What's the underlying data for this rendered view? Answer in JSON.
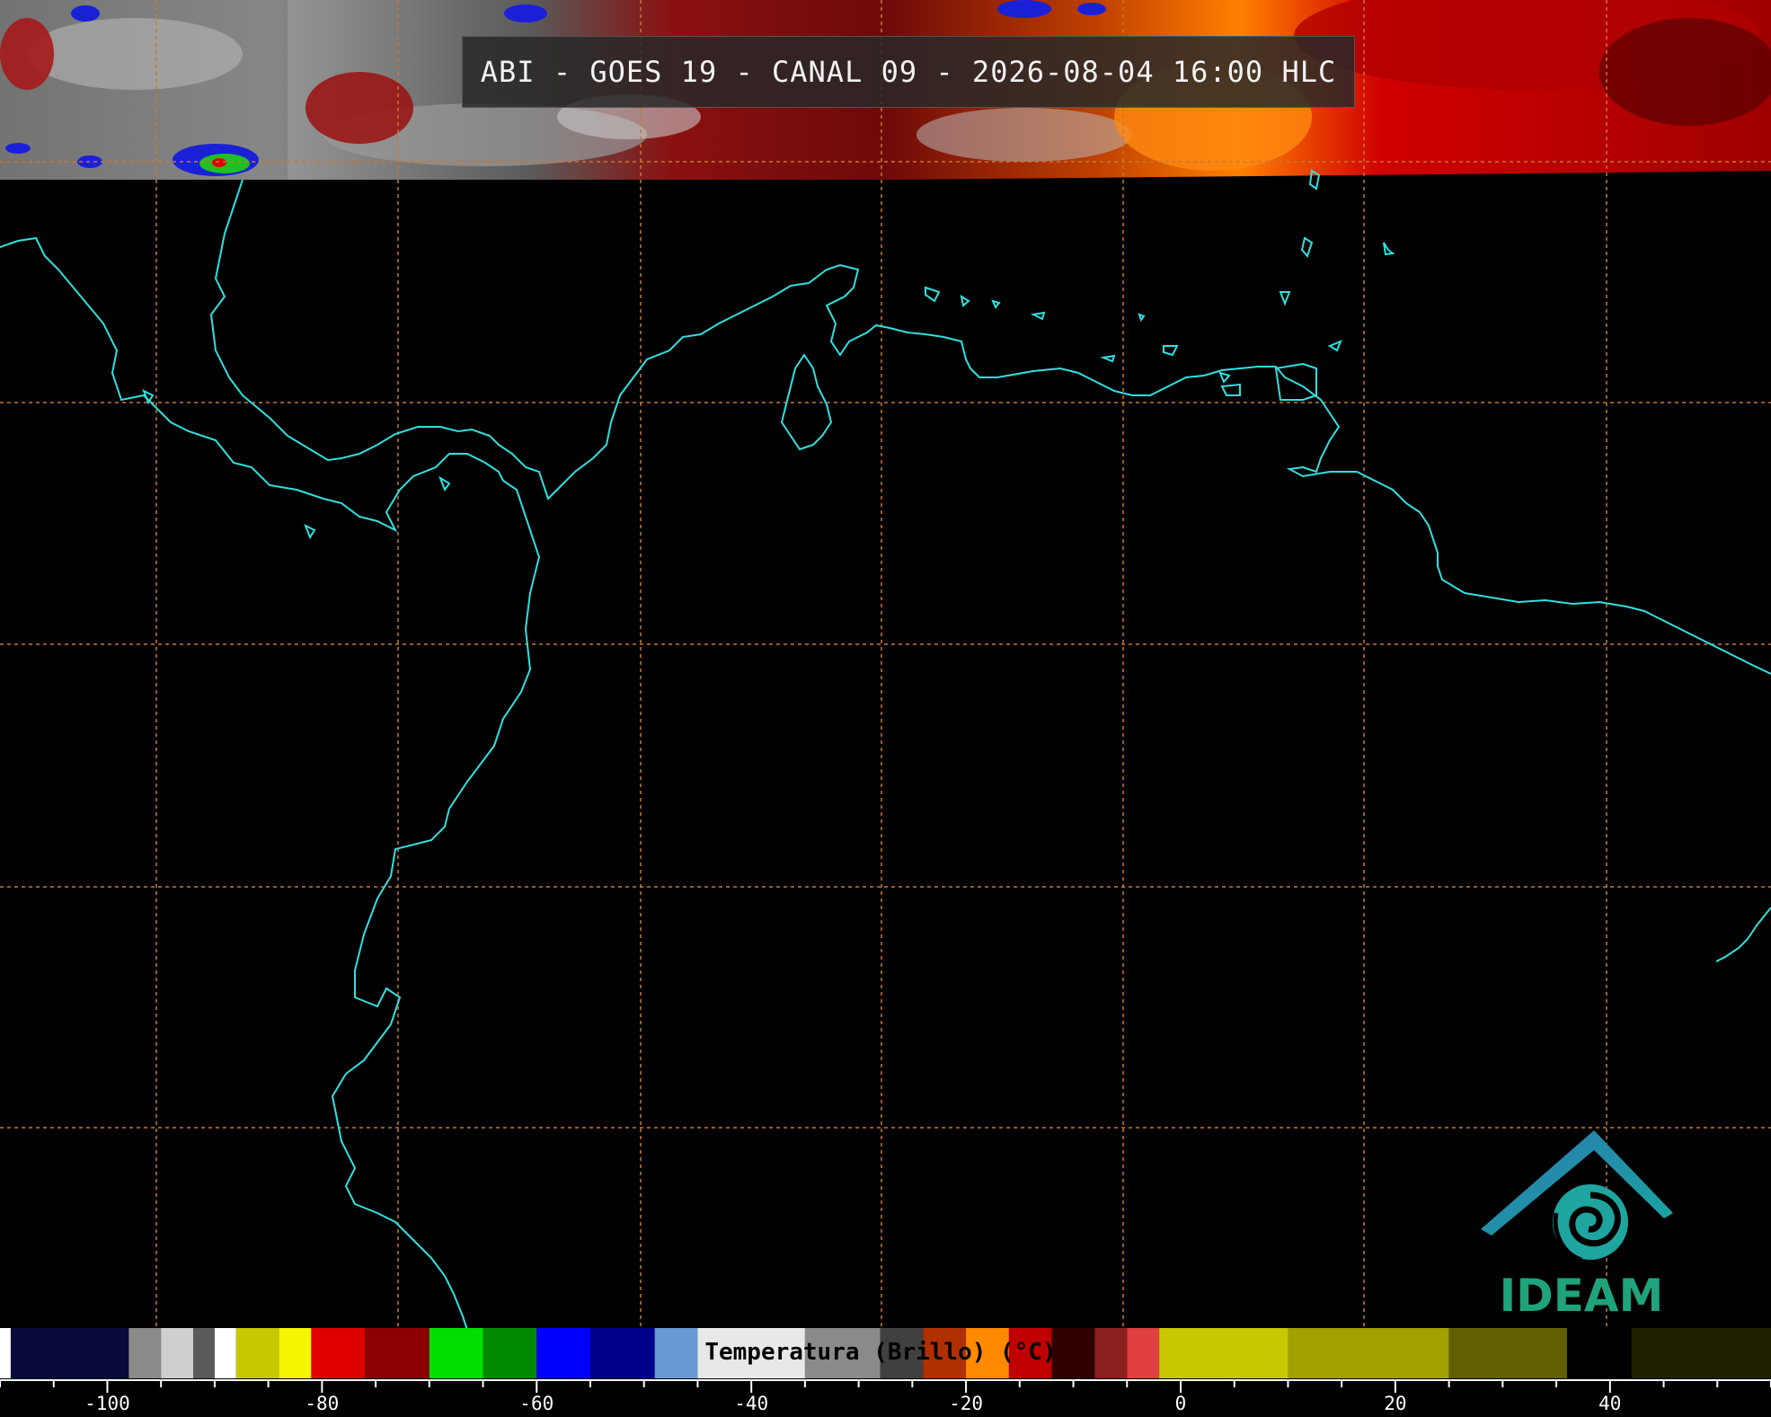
{
  "title": "ABI - GOES 19 - CANAL 09 - 2026-08-04 16:00 HLC",
  "colorbar": {
    "label": "Temperatura (Brillo) (°C)",
    "tick_labels": [
      "-100",
      "-80",
      "-60",
      "-40",
      "-20",
      "0",
      "20",
      "40"
    ],
    "range": [
      -110,
      55
    ],
    "segments": [
      {
        "from": -110,
        "to": -109,
        "color": "#ffffff"
      },
      {
        "from": -109,
        "to": -98,
        "color": "#0a0a3c"
      },
      {
        "from": -98,
        "to": -95,
        "color": "#8a8a8a"
      },
      {
        "from": -95,
        "to": -92,
        "color": "#cfcfcf"
      },
      {
        "from": -92,
        "to": -90,
        "color": "#5a5a5a"
      },
      {
        "from": -90,
        "to": -88,
        "color": "#ffffff"
      },
      {
        "from": -88,
        "to": -84,
        "color": "#c8c800"
      },
      {
        "from": -84,
        "to": -81,
        "color": "#f5f500"
      },
      {
        "from": -81,
        "to": -76,
        "color": "#e00000"
      },
      {
        "from": -76,
        "to": -70,
        "color": "#8b0000"
      },
      {
        "from": -70,
        "to": -65,
        "color": "#00e000"
      },
      {
        "from": -65,
        "to": -60,
        "color": "#008a00"
      },
      {
        "from": -60,
        "to": -55,
        "color": "#0000ff"
      },
      {
        "from": -55,
        "to": -49,
        "color": "#00008b"
      },
      {
        "from": -49,
        "to": -45,
        "color": "#6a9ad6"
      },
      {
        "from": -45,
        "to": -35,
        "color": "#e8e8e8"
      },
      {
        "from": -35,
        "to": -28,
        "color": "#8a8a8a"
      },
      {
        "from": -28,
        "to": -24,
        "color": "#404040"
      },
      {
        "from": -24,
        "to": -20,
        "color": "#b03000"
      },
      {
        "from": -20,
        "to": -16,
        "color": "#ff8a00"
      },
      {
        "from": -16,
        "to": -12,
        "color": "#c00000"
      },
      {
        "from": -12,
        "to": -8,
        "color": "#300000"
      },
      {
        "from": -8,
        "to": -5,
        "color": "#8b2020"
      },
      {
        "from": -5,
        "to": -2,
        "color": "#e04040"
      },
      {
        "from": -2,
        "to": 10,
        "color": "#c8c800"
      },
      {
        "from": 10,
        "to": 25,
        "color": "#a0a000"
      },
      {
        "from": 25,
        "to": 36,
        "color": "#606000"
      },
      {
        "from": 36,
        "to": 42,
        "color": "#000000"
      },
      {
        "from": 42,
        "to": 55,
        "color": "#202000"
      }
    ]
  },
  "logo": {
    "text": "IDEAM"
  },
  "colors": {
    "coastline": "#30e0e0",
    "grid": "#c87832",
    "background": "#000000"
  }
}
